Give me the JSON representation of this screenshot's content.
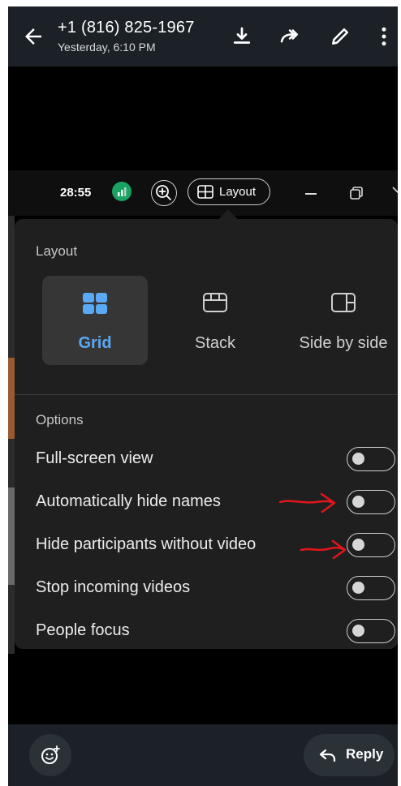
{
  "header": {
    "title": "+1 (816) 825-1967",
    "subtitle": "Yesterday, 6:10 PM",
    "icons": [
      "back-arrow-icon",
      "download-icon",
      "forward-icon",
      "edit-icon",
      "more-vert-icon"
    ]
  },
  "meeting_toolbar": {
    "timer": "28:55",
    "layout_label": "Layout"
  },
  "layout_panel": {
    "heading": "Layout",
    "layouts": [
      {
        "name": "Grid",
        "icon": "grid-icon",
        "selected": true
      },
      {
        "name": "Stack",
        "icon": "stack-icon",
        "selected": false
      },
      {
        "name": "Side by side",
        "icon": "side-by-side-icon",
        "selected": false
      }
    ],
    "options_heading": "Options",
    "options": [
      {
        "label": "Full-screen view",
        "on": false
      },
      {
        "label": "Automatically hide names",
        "on": false
      },
      {
        "label": "Hide participants without video",
        "on": false
      },
      {
        "label": "Stop incoming videos",
        "on": false
      },
      {
        "label": "People focus",
        "on": false
      }
    ]
  },
  "bottom_bar": {
    "reply_label": "Reply"
  },
  "colors": {
    "accent": "#5aa9f5",
    "annotation": "#e0161c",
    "signal": "#1aa260"
  }
}
